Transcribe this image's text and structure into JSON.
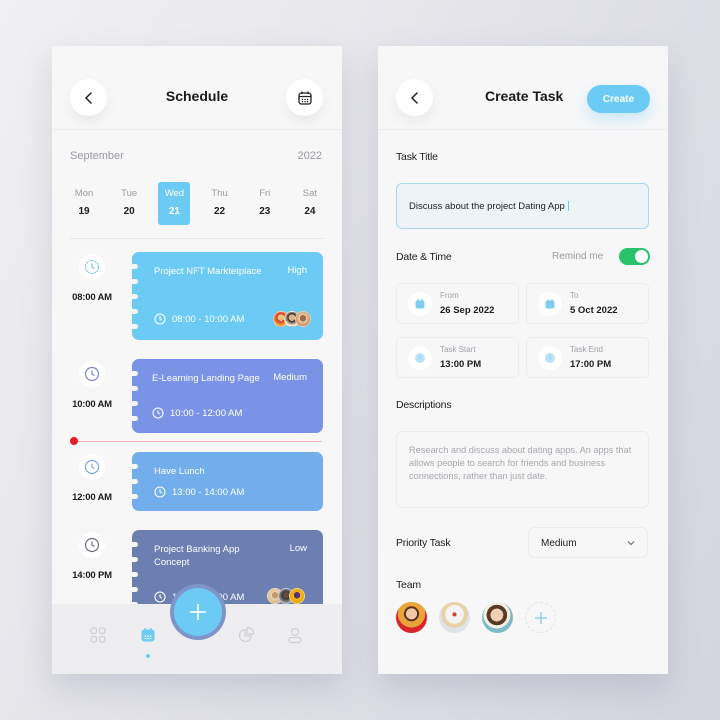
{
  "schedule_screen": {
    "title": "Schedule",
    "back_icon": "chevron-left-icon",
    "calendar_icon": "calendar-icon",
    "month": "September",
    "year": "2022",
    "days": [
      {
        "name": "Mon",
        "date": "19",
        "selected": false
      },
      {
        "name": "Tue",
        "date": "20",
        "selected": false
      },
      {
        "name": "Wed",
        "date": "21",
        "selected": true
      },
      {
        "name": "Thu",
        "date": "22",
        "selected": false
      },
      {
        "name": "Fri",
        "date": "23",
        "selected": false
      },
      {
        "name": "Sat",
        "date": "24",
        "selected": false
      }
    ],
    "time_slots": [
      "08:00 AM",
      "10:00 AM",
      "12:00 AM",
      "14:00 PM"
    ],
    "tasks": [
      {
        "title": "Project NFT Marktetplace",
        "priority": "High",
        "time": "08:00 - 10:00 AM",
        "color": "#6ccbf5",
        "has_avatars": true
      },
      {
        "title": "E-Learning Landing Page",
        "priority": "Medium",
        "time": "10:00 - 12:00 AM",
        "color": "#7b93e6",
        "has_avatars": false
      },
      {
        "title": "Have Lunch",
        "priority": "",
        "time": "13:00 - 14:00 AM",
        "color": "#73aeec",
        "has_avatars": false
      },
      {
        "title": "Project Banking App Concept",
        "priority": "Low",
        "time": "13:00 - 15:00 AM",
        "color": "#6b7fb0",
        "has_avatars": true
      }
    ],
    "now_indicator_color": "#e01e24",
    "bottom_nav": [
      {
        "name": "dashboard",
        "icon": "grid-icon",
        "active": false
      },
      {
        "name": "calendar",
        "icon": "calendar-icon",
        "active": true
      },
      {
        "name": "add",
        "icon": "plus-icon",
        "active": false
      },
      {
        "name": "stats",
        "icon": "pie-chart-icon",
        "active": false
      },
      {
        "name": "profile",
        "icon": "user-icon",
        "active": false
      }
    ]
  },
  "create_task_screen": {
    "title": "Create Task",
    "create_label": "Create",
    "task_title_label": "Task Title",
    "task_title_value": "Discuss about the project Dating App",
    "date_time_label": "Date & Time",
    "remind_label": "Remind me",
    "remind_on": true,
    "from_label": "From",
    "from_value": "26 Sep 2022",
    "to_label": "To",
    "to_value": "5 Oct 2022",
    "task_start_label": "Task Start",
    "task_start_value": "13:00 PM",
    "task_end_label": "Task End",
    "task_end_value": "17:00 PM",
    "descriptions_label": "Descriptions",
    "descriptions_value": "Research and discuss about dating apps. An apps that allows people to search for friends and business connections, rather than just date.",
    "priority_label": "Priority Task",
    "priority_value": "Medium",
    "team_label": "Team",
    "team_members": 3
  },
  "colors": {
    "accent": "#6ccbf5",
    "toggle_on": "#27c26a"
  }
}
